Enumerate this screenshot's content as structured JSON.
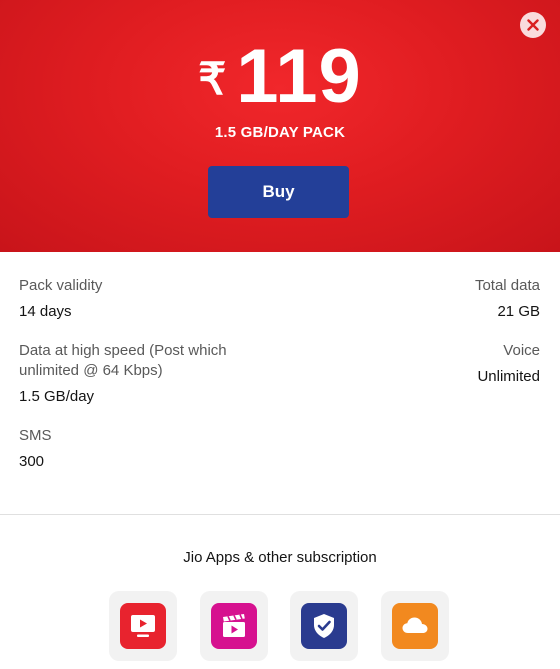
{
  "plan": {
    "currency_symbol": "₹",
    "price": "119",
    "pack_name": "1.5 GB/DAY PACK",
    "buy_label": "Buy"
  },
  "details": {
    "validity_label": "Pack validity",
    "validity_value": "14 days",
    "total_data_label": "Total data",
    "total_data_value": "21 GB",
    "high_speed_label_line1": "Data at high speed (Post which",
    "high_speed_label_line2": "unlimited @ 64 Kbps)",
    "high_speed_value": "1.5 GB/day",
    "voice_label": "Voice",
    "voice_value": "Unlimited",
    "sms_label": "SMS",
    "sms_value": "300"
  },
  "apps": {
    "heading": "Jio Apps & other subscription",
    "items": [
      {
        "icon": "jiotv-icon",
        "color": "#e8232e"
      },
      {
        "icon": "jiocinema-icon",
        "color": "#d6118f"
      },
      {
        "icon": "jiosecurity-icon",
        "color": "#2a3b8f"
      },
      {
        "icon": "jiocloud-icon",
        "color": "#f2891f"
      }
    ]
  },
  "colors": {
    "hero_red": "#e01d21",
    "buy_blue": "#233f98"
  }
}
